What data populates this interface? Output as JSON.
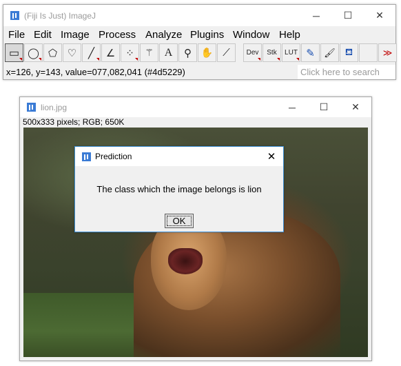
{
  "main_window": {
    "title": "(Fiji Is Just) ImageJ",
    "controls": {
      "minimize": "─",
      "maximize": "☐",
      "close": "✕"
    },
    "menus": [
      "File",
      "Edit",
      "Image",
      "Process",
      "Analyze",
      "Plugins",
      "Window",
      "Help"
    ],
    "tools": [
      {
        "name": "rectangle-tool-icon",
        "glyph": "▭"
      },
      {
        "name": "oval-tool-icon",
        "glyph": "◯"
      },
      {
        "name": "polygon-tool-icon",
        "glyph": "⬠"
      },
      {
        "name": "freehand-tool-icon",
        "glyph": "♡"
      },
      {
        "name": "line-tool-icon",
        "glyph": "╱"
      },
      {
        "name": "angle-tool-icon",
        "glyph": "∠"
      },
      {
        "name": "multipoint-tool-icon",
        "glyph": "⁘"
      },
      {
        "name": "wand-tool-icon",
        "glyph": "⚚"
      },
      {
        "name": "text-tool-icon",
        "glyph": "A"
      },
      {
        "name": "magnifier-tool-icon",
        "glyph": "⚲"
      },
      {
        "name": "hand-tool-icon",
        "glyph": "✋"
      },
      {
        "name": "color-picker-tool-icon",
        "glyph": "⟋"
      },
      {
        "name": "dev-tool-label",
        "glyph": "Dev"
      },
      {
        "name": "stk-tool-label",
        "glyph": "Stk"
      },
      {
        "name": "lut-tool-label",
        "glyph": "LUT"
      },
      {
        "name": "pencil-tool-icon",
        "glyph": "✎"
      },
      {
        "name": "brush-tool-icon",
        "glyph": "🖌"
      },
      {
        "name": "flood-fill-tool-icon",
        "glyph": "⛾"
      },
      {
        "name": "blank-tool-slot",
        "glyph": ""
      },
      {
        "name": "more-tools-icon",
        "glyph": "≫"
      }
    ],
    "status": "x=126, y=143, value=077,082,041 (#4d5229)",
    "search_placeholder": "Click here to search"
  },
  "image_window": {
    "title": "lion.jpg",
    "controls": {
      "minimize": "─",
      "maximize": "☐",
      "close": "✕"
    },
    "info": "500x333 pixels; RGB; 650K"
  },
  "dialog": {
    "title": "Prediction",
    "close": "✕",
    "message": "The class which the image belongs is lion",
    "ok_label": "OK"
  },
  "colors": {
    "accent_red": "#c00000",
    "status_value_hex": "#4d5229",
    "dialog_border": "#3c8fd6"
  }
}
